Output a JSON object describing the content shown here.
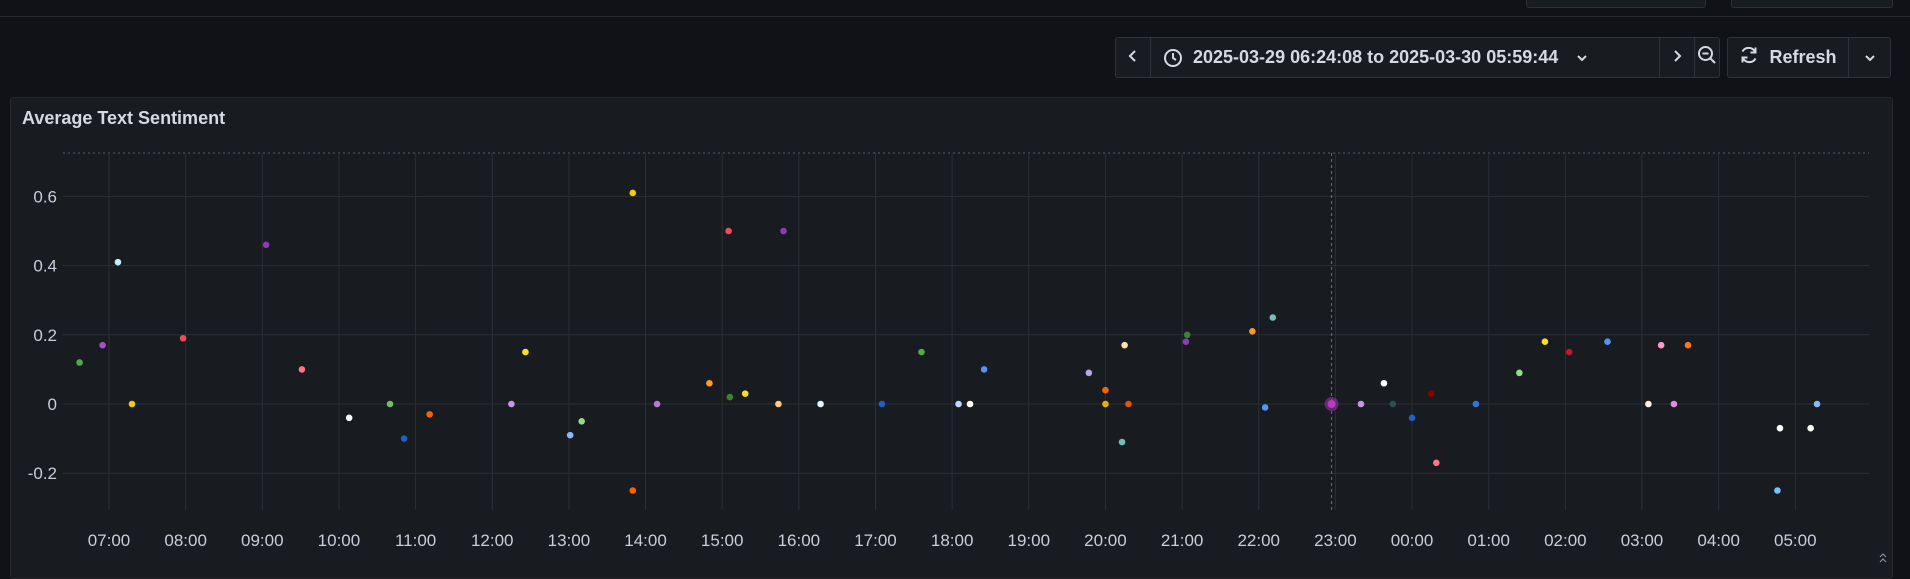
{
  "toolbar": {
    "prev_label": "‹",
    "time_range": "2025-03-29 06:24:08 to 2025-03-30 05:59:44",
    "next_label": "›",
    "refresh_label": "Refresh"
  },
  "panel": {
    "title": "Average Text Sentiment"
  },
  "chart_data": {
    "type": "scatter",
    "title": "Average Text Sentiment",
    "xlabel": "",
    "ylabel": "",
    "x_ticks": [
      "07:00",
      "08:00",
      "09:00",
      "10:00",
      "11:00",
      "12:00",
      "13:00",
      "14:00",
      "15:00",
      "16:00",
      "17:00",
      "18:00",
      "19:00",
      "20:00",
      "21:00",
      "22:00",
      "23:00",
      "00:00",
      "01:00",
      "02:00",
      "03:00",
      "04:00",
      "05:00"
    ],
    "y_ticks": [
      "0.6",
      "0.4",
      "0.2",
      "0",
      "-0.2"
    ],
    "ylim": [
      -0.35,
      0.71
    ],
    "grid": true,
    "hover_marker_time": "22:57",
    "points": [
      {
        "t": "06:37",
        "v": 0.12,
        "color": "#56a64b"
      },
      {
        "t": "06:55",
        "v": 0.17,
        "color": "#a352cc"
      },
      {
        "t": "07:07",
        "v": 0.41,
        "color": "#c0f0ff"
      },
      {
        "t": "07:18",
        "v": 0.0,
        "color": "#f2cc0c"
      },
      {
        "t": "07:58",
        "v": 0.19,
        "color": "#f2495c"
      },
      {
        "t": "09:03",
        "v": 0.46,
        "color": "#8f3bb8"
      },
      {
        "t": "09:31",
        "v": 0.1,
        "color": "#ff7383"
      },
      {
        "t": "10:08",
        "v": -0.04,
        "color": "#ffffff"
      },
      {
        "t": "10:40",
        "v": 0.0,
        "color": "#73bf69"
      },
      {
        "t": "10:51",
        "v": -0.1,
        "color": "#1f60c4"
      },
      {
        "t": "11:11",
        "v": -0.03,
        "color": "#fa6400"
      },
      {
        "t": "12:15",
        "v": 0.0,
        "color": "#ca95e5"
      },
      {
        "t": "12:26",
        "v": 0.15,
        "color": "#fade2a"
      },
      {
        "t": "13:01",
        "v": -0.09,
        "color": "#8ab8ff"
      },
      {
        "t": "13:10",
        "v": -0.05,
        "color": "#96d98d"
      },
      {
        "t": "13:50",
        "v": 0.61,
        "color": "#f2cc0c"
      },
      {
        "t": "13:50",
        "v": -0.25,
        "color": "#fa6400"
      },
      {
        "t": "14:09",
        "v": 0.0,
        "color": "#b877d9"
      },
      {
        "t": "14:50",
        "v": 0.06,
        "color": "#ff9830"
      },
      {
        "t": "15:05",
        "v": 0.5,
        "color": "#f2495c"
      },
      {
        "t": "15:06",
        "v": 0.02,
        "color": "#37872d"
      },
      {
        "t": "15:18",
        "v": 0.03,
        "color": "#fade2a"
      },
      {
        "t": "15:44",
        "v": 0.0,
        "color": "#ffcb7d"
      },
      {
        "t": "15:48",
        "v": 0.5,
        "color": "#8f3bb8"
      },
      {
        "t": "16:17",
        "v": 0.0,
        "color": "#e0f7ff"
      },
      {
        "t": "17:05",
        "v": 0.0,
        "color": "#1f60c4"
      },
      {
        "t": "17:36",
        "v": 0.15,
        "color": "#56a64b"
      },
      {
        "t": "18:05",
        "v": 0.0,
        "color": "#c0d8ff"
      },
      {
        "t": "18:14",
        "v": 0.0,
        "color": "#ffffff"
      },
      {
        "t": "18:25",
        "v": 0.1,
        "color": "#5794f2"
      },
      {
        "t": "19:47",
        "v": 0.09,
        "color": "#b8a5e8"
      },
      {
        "t": "20:00",
        "v": 0.04,
        "color": "#fa6400"
      },
      {
        "t": "20:00",
        "v": 0.0,
        "color": "#e0b400"
      },
      {
        "t": "20:13",
        "v": -0.11,
        "color": "#73bfb8"
      },
      {
        "t": "20:15",
        "v": 0.17,
        "color": "#ffe0b0"
      },
      {
        "t": "20:18",
        "v": 0.0,
        "color": "#e55400"
      },
      {
        "t": "21:03",
        "v": 0.18,
        "color": "#8f3bb8"
      },
      {
        "t": "21:04",
        "v": 0.2,
        "color": "#37872d"
      },
      {
        "t": "21:55",
        "v": 0.21,
        "color": "#ff9830"
      },
      {
        "t": "22:05",
        "v": -0.01,
        "color": "#5794f2"
      },
      {
        "t": "22:11",
        "v": 0.25,
        "color": "#73bfb8"
      },
      {
        "t": "23:20",
        "v": 0.0,
        "color": "#ca95e5"
      },
      {
        "t": "23:38",
        "v": 0.06,
        "color": "#ffffff"
      },
      {
        "t": "23:45",
        "v": 0.0,
        "color": "#2f4f4f"
      },
      {
        "t": "00:00",
        "v": -0.04,
        "color": "#1f60c4"
      },
      {
        "t": "00:15",
        "v": 0.03,
        "color": "#8b0000"
      },
      {
        "t": "00:19",
        "v": -0.17,
        "color": "#ff7383"
      },
      {
        "t": "00:50",
        "v": 0.0,
        "color": "#3274d9"
      },
      {
        "t": "01:24",
        "v": 0.09,
        "color": "#96d98d"
      },
      {
        "t": "01:44",
        "v": 0.18,
        "color": "#fade2a"
      },
      {
        "t": "02:03",
        "v": 0.15,
        "color": "#c4162a"
      },
      {
        "t": "02:33",
        "v": 0.18,
        "color": "#5794f2"
      },
      {
        "t": "03:05",
        "v": 0.0,
        "color": "#ffeed8"
      },
      {
        "t": "03:15",
        "v": 0.17,
        "color": "#ff99cc"
      },
      {
        "t": "03:25",
        "v": 0.0,
        "color": "#e68ae6"
      },
      {
        "t": "03:36",
        "v": 0.17,
        "color": "#ff780a"
      },
      {
        "t": "04:46",
        "v": -0.25,
        "color": "#73c2fb"
      },
      {
        "t": "04:48",
        "v": -0.07,
        "color": "#ffffff"
      },
      {
        "t": "05:12",
        "v": -0.07,
        "color": "#ffffff"
      },
      {
        "t": "05:17",
        "v": 0.0,
        "color": "#8ab8ff"
      },
      {
        "t": "22:57",
        "v": 0.0,
        "color": "#b83cc2",
        "highlight": true
      }
    ]
  },
  "icons": {
    "clock": "clock-icon",
    "chevron_down": "chevron-down-icon",
    "zoom_out": "zoom-out-icon",
    "refresh": "refresh-icon"
  }
}
